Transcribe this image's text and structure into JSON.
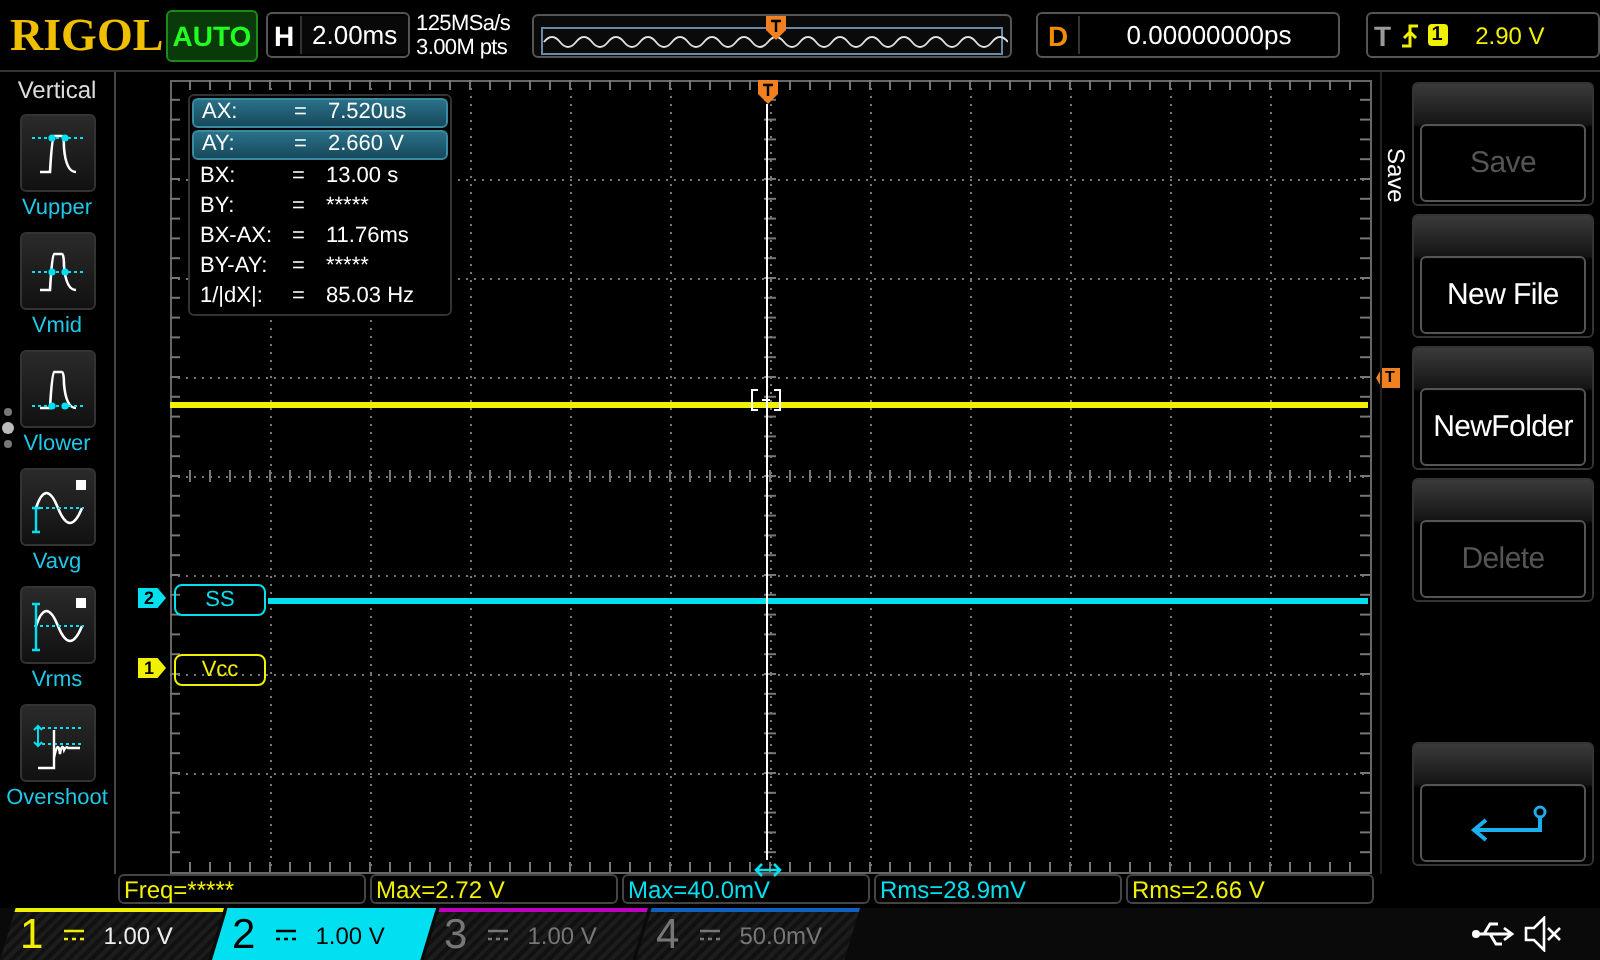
{
  "logo": "RIGOL",
  "run_mode": "AUTO",
  "timebase": {
    "label": "H",
    "value": "2.00ms"
  },
  "acquisition": {
    "sample_rate": "125MSa/s",
    "memory_depth": "3.00M pts"
  },
  "delay": {
    "label": "D",
    "value": "0.00000000ps"
  },
  "trigger": {
    "label": "T",
    "source": "1",
    "level": "2.90 V"
  },
  "vertical_menu": {
    "title": "Vertical",
    "items": [
      {
        "label": "Vupper",
        "kind": "vupper"
      },
      {
        "label": "Vmid",
        "kind": "vmid"
      },
      {
        "label": "Vlower",
        "kind": "vlower"
      },
      {
        "label": "Vavg",
        "kind": "vavg"
      },
      {
        "label": "Vrms",
        "kind": "vrms"
      },
      {
        "label": "Overshoot",
        "kind": "overshoot"
      }
    ]
  },
  "cursor_readout": [
    {
      "name": "AX:",
      "sign": "=",
      "value": "7.520us",
      "selected": true
    },
    {
      "name": "AY:",
      "sign": "=",
      "value": "2.660 V",
      "selected": true
    },
    {
      "name": "BX:",
      "sign": "=",
      "value": "13.00 s",
      "selected": false
    },
    {
      "name": "BY:",
      "sign": "=",
      "value": "*****",
      "selected": false
    },
    {
      "name": "BX-AX:",
      "sign": "=",
      "value": "11.76ms",
      "selected": false
    },
    {
      "name": "BY-AY:",
      "sign": "=",
      "value": "*****",
      "selected": false
    },
    {
      "name": "1/|dX|:",
      "sign": "=",
      "value": "85.03 Hz",
      "selected": false
    }
  ],
  "traces": [
    {
      "channel": "2",
      "label": "SS",
      "color": "#00e0f0"
    },
    {
      "channel": "1",
      "label": "Vcc",
      "color": "#f0f000"
    }
  ],
  "trigger_level_marker": "T",
  "save_menu": {
    "title": "Save",
    "buttons": [
      {
        "kind": "text",
        "label": "Save",
        "disabled": true
      },
      {
        "kind": "text",
        "label": "New File",
        "disabled": false
      },
      {
        "kind": "text",
        "label": "NewFolder",
        "disabled": false
      },
      {
        "kind": "text",
        "label": "Delete",
        "disabled": true
      },
      {
        "kind": "back"
      }
    ]
  },
  "measurements": [
    {
      "text": "Freq=*****",
      "color": "#f0f000"
    },
    {
      "text": "Max=2.72 V",
      "color": "#f0f000"
    },
    {
      "text": "Max=40.0mV",
      "color": "#00e0f0"
    },
    {
      "text": "Rms=28.9mV",
      "color": "#00e0f0"
    },
    {
      "text": "Rms=2.66 V",
      "color": "#f0f000"
    }
  ],
  "channels": [
    {
      "number": "1",
      "scale": "1.00 V",
      "on": true,
      "selected": false,
      "color": "#f0f000"
    },
    {
      "number": "2",
      "scale": "1.00 V",
      "on": true,
      "selected": true,
      "color": "#00e0f0"
    },
    {
      "number": "3",
      "scale": "1.00 V",
      "on": false,
      "selected": false,
      "color": "#c000c0"
    },
    {
      "number": "4",
      "scale": "50.0mV",
      "on": false,
      "selected": false,
      "color": "#1060c0"
    }
  ]
}
